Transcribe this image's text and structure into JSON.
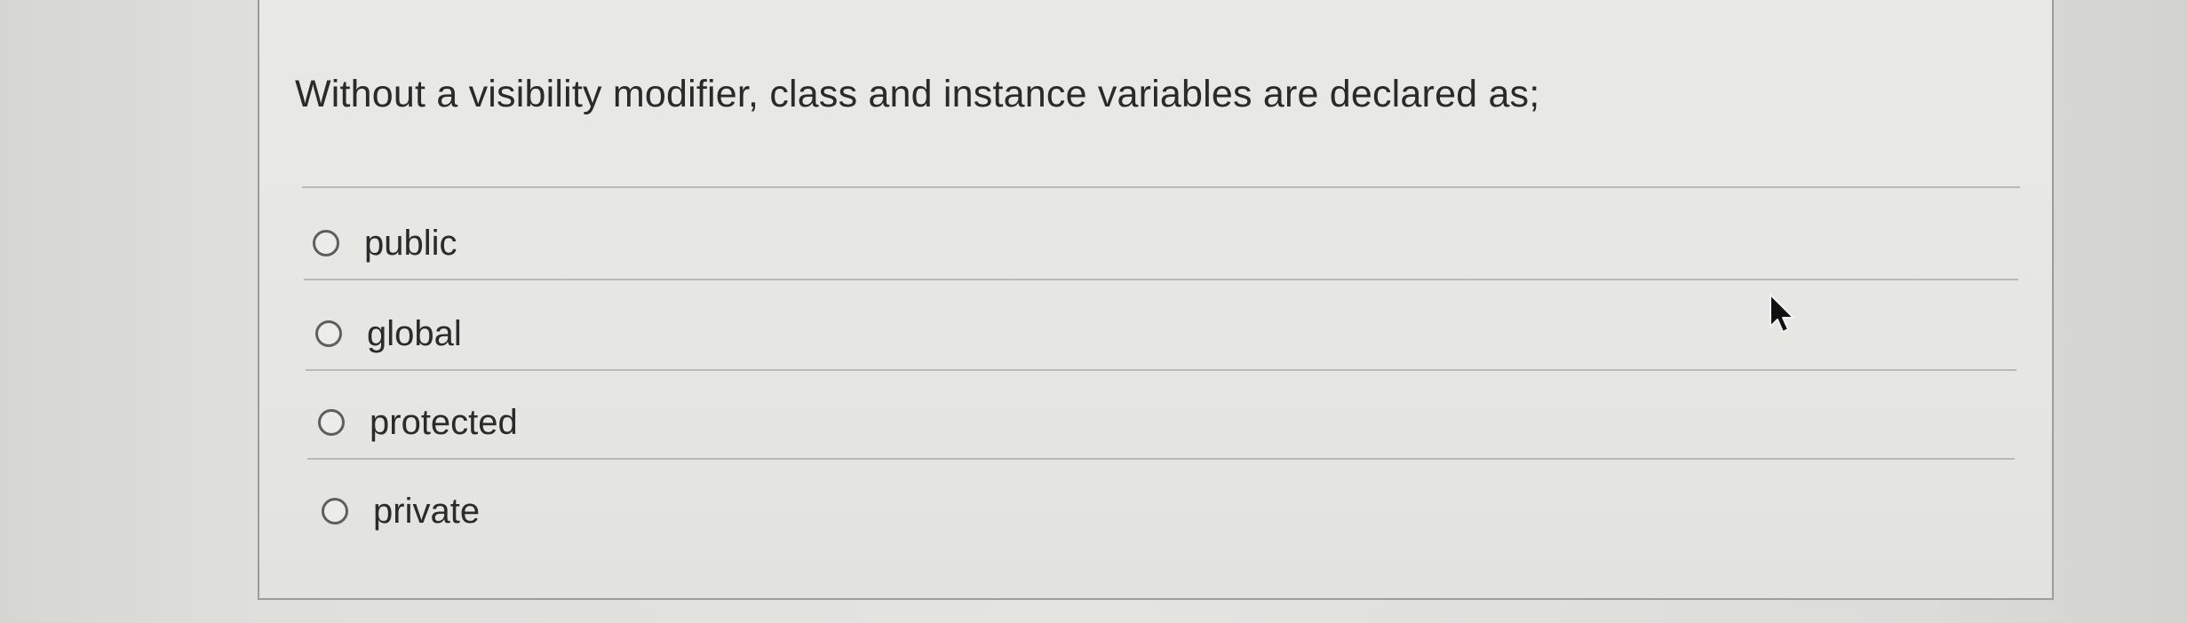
{
  "question": {
    "text": "Without a visibility modifier, class and instance variables are declared as;"
  },
  "options": [
    {
      "label": "public",
      "selected": false
    },
    {
      "label": "global",
      "selected": false
    },
    {
      "label": "protected",
      "selected": false
    },
    {
      "label": "private",
      "selected": false
    }
  ],
  "cursor": {
    "icon": "mouse-pointer-icon"
  }
}
